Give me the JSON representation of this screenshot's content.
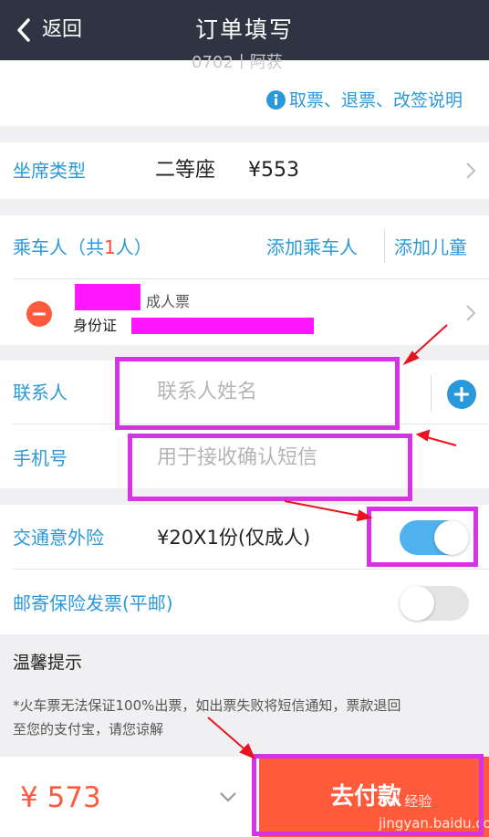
{
  "header": {
    "back_label": "返回",
    "title": "订单填写"
  },
  "top": {
    "partial_text": "0702丨阿获",
    "ticket_info": "取票、退票、改签说明"
  },
  "seat": {
    "label": "坐席类型",
    "type": "二等座",
    "price": "¥553"
  },
  "passengers": {
    "label_prefix": "乘车人（共",
    "count": "1",
    "label_suffix": "人）",
    "add_passenger": "添加乘车人",
    "add_child": "添加儿童",
    "ticket_type": "成人票",
    "id_type": "身份证"
  },
  "contact": {
    "name_label": "联系人",
    "name_placeholder": "联系人姓名",
    "phone_label": "手机号",
    "phone_placeholder": "用于接收确认短信"
  },
  "insurance": {
    "label": "交通意外险",
    "detail": "¥20X1份(仅成人)",
    "enabled": true,
    "invoice_label": "邮寄保险发票(平邮)",
    "invoice_enabled": false
  },
  "tips": {
    "title": "温馨提示",
    "line1": "*火车票无法保证100%出票，如出票失败将短信通知，票款退回",
    "line2": "至您的支付宝，请您谅解"
  },
  "footer": {
    "total": "¥ 573",
    "pay_label": "去付款"
  },
  "watermark": "Bai 经验 jingyan.baidu.com",
  "colors": {
    "header": "#2f3443",
    "blue": "#2b99d9",
    "price": "#ff5a3c",
    "pay": "#ff5a3c",
    "highlight": "#d832e6",
    "arrow": "#e8131f"
  }
}
